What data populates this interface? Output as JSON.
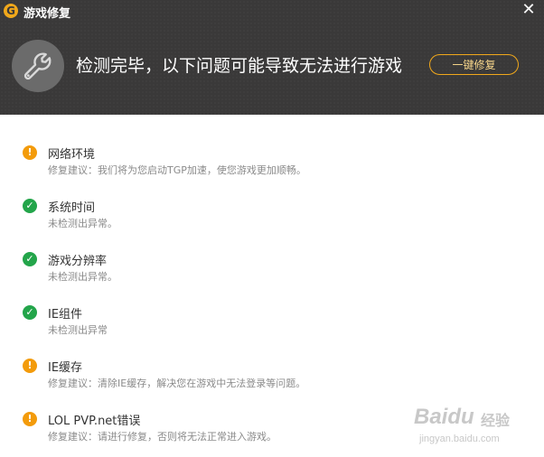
{
  "window": {
    "logo_glyph": "G",
    "title": "游戏修复",
    "close_glyph": "✕"
  },
  "header": {
    "icon": "wrench-icon",
    "headline": "检测完毕，以下问题可能导致无法进行游戏",
    "fix_button_label": "一键修复"
  },
  "items": [
    {
      "status": "warning",
      "title": "网络环境",
      "desc": "修复建议：我们将为您启动TGP加速，使您游戏更加顺畅。"
    },
    {
      "status": "ok",
      "title": "系统时间",
      "desc": "未检测出异常。"
    },
    {
      "status": "ok",
      "title": "游戏分辨率",
      "desc": "未检测出异常。"
    },
    {
      "status": "ok",
      "title": "IE组件",
      "desc": "未检测出异常"
    },
    {
      "status": "warning",
      "title": "IE缓存",
      "desc": "修复建议：清除IE缓存，解决您在游戏中无法登录等问题。"
    },
    {
      "status": "warning",
      "title": "LOL PVP.net错误",
      "desc": "修复建议：请进行修复，否则将无法正常进入游戏。"
    }
  ],
  "watermark": {
    "brand": "Baidu",
    "suffix": "经验",
    "url": "jingyan.baidu.com"
  },
  "colors": {
    "header_bg": "#3a3939",
    "accent": "#f1a81b",
    "warning": "#f39b0b",
    "ok": "#23a54a"
  },
  "status_glyphs": {
    "warning": "!",
    "ok": "✓"
  }
}
